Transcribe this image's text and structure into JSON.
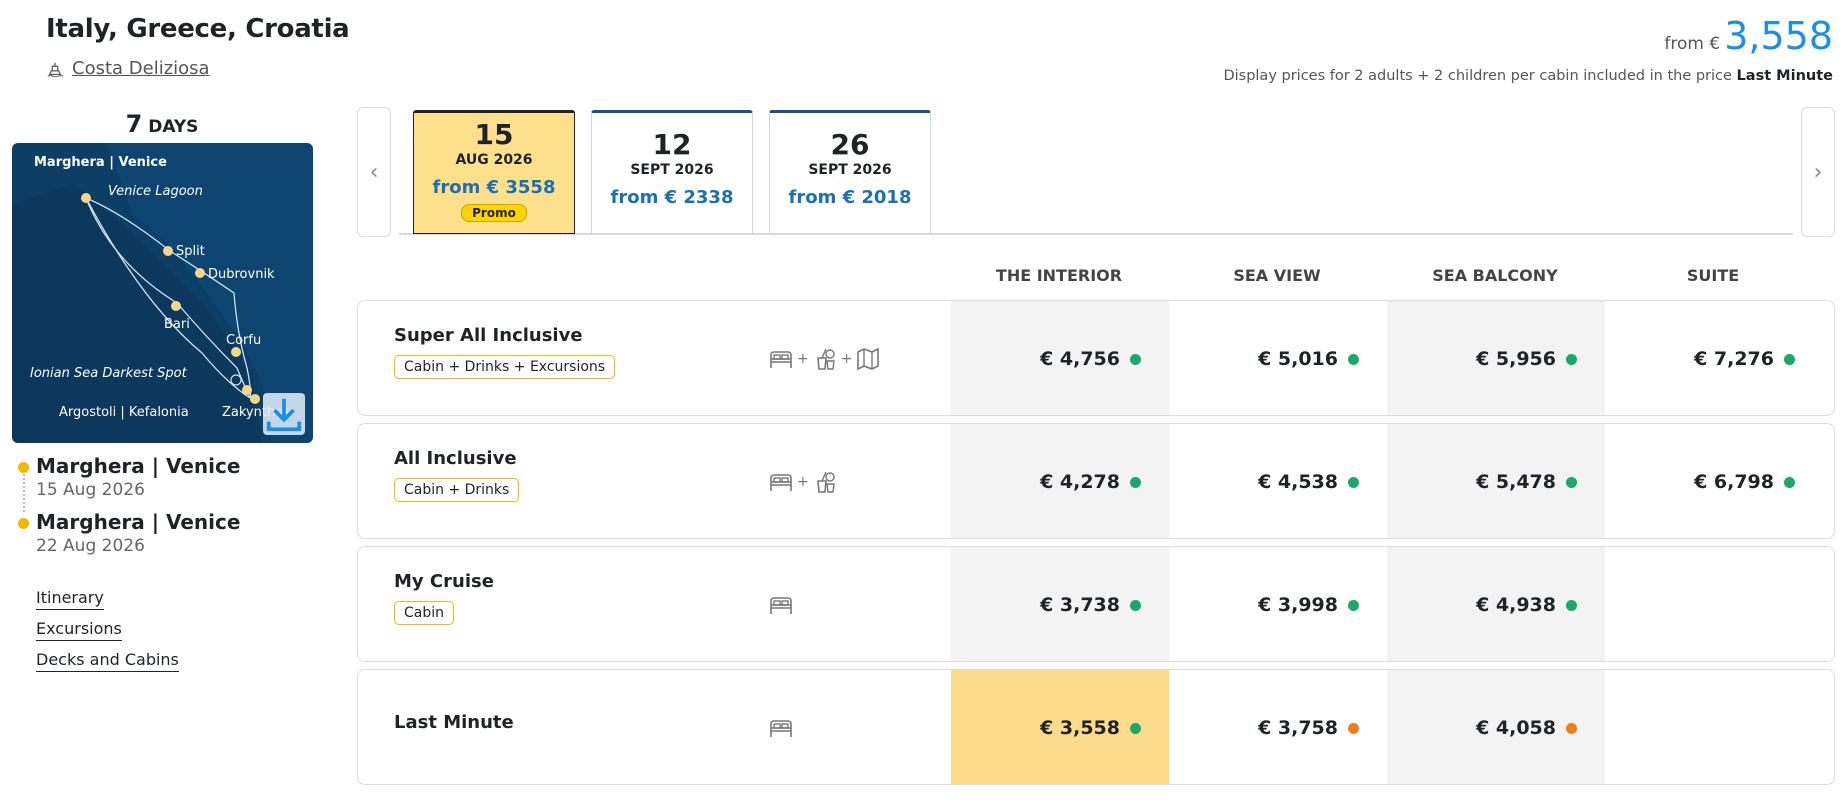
{
  "header": {
    "title": "Italy, Greece, Croatia",
    "ship_name": "Costa Deliziosa",
    "from_label": "from €",
    "from_price": "3,558",
    "subtitle_prefix": "Display prices for 2 adults + 2 children per cabin included in the price",
    "subtitle_bold": "Last Minute"
  },
  "duration": {
    "number": "7",
    "unit": "DAYS"
  },
  "map": {
    "title": "Marghera | Venice",
    "labels": [
      "Venice Lagoon",
      "Split",
      "Dubrovnik",
      "Bari",
      "Corfu",
      "Ionian Sea Darkest Spot",
      "Argostoli | Kefalonia",
      "Zakynthos"
    ],
    "download_icon": "download-icon"
  },
  "stops": [
    {
      "name": "Marghera | Venice",
      "date": "15 Aug 2026"
    },
    {
      "name": "Marghera | Venice",
      "date": "22 Aug 2026"
    }
  ],
  "links": [
    "Itinerary",
    "Excursions",
    "Decks and Cabins"
  ],
  "dates": [
    {
      "day": "15",
      "month": "AUG 2026",
      "price": "from € 3558",
      "promo": "Promo",
      "active": true
    },
    {
      "day": "12",
      "month": "SEPT 2026",
      "price": "from € 2338"
    },
    {
      "day": "26",
      "month": "SEPT 2026",
      "price": "from € 2018"
    }
  ],
  "columns": [
    "THE INTERIOR",
    "SEA VIEW",
    "SEA BALCONY",
    "SUITE"
  ],
  "plus": "+",
  "colors": {
    "accent": "#1a8fe3",
    "available": "#1aa86b",
    "limited": "#f07d1a",
    "highlight": "#fcdb8a",
    "badge_border": "#f5b800"
  },
  "rows": [
    {
      "name": "Super All Inclusive",
      "badge": "Cabin + Drinks + Excursions",
      "icons": [
        "bed-icon",
        "drinks-icon",
        "map-icon"
      ],
      "prices": [
        {
          "v": "€ 4,756",
          "s": "available"
        },
        {
          "v": "€ 5,016",
          "s": "available"
        },
        {
          "v": "€ 5,956",
          "s": "available"
        },
        {
          "v": "€ 7,276",
          "s": "available"
        }
      ]
    },
    {
      "name": "All Inclusive",
      "badge": "Cabin + Drinks",
      "icons": [
        "bed-icon",
        "drinks-icon"
      ],
      "prices": [
        {
          "v": "€ 4,278",
          "s": "available"
        },
        {
          "v": "€ 4,538",
          "s": "available"
        },
        {
          "v": "€ 5,478",
          "s": "available"
        },
        {
          "v": "€ 6,798",
          "s": "available"
        }
      ]
    },
    {
      "name": "My Cruise",
      "badge": "Cabin",
      "icons": [
        "bed-icon"
      ],
      "prices": [
        {
          "v": "€ 3,738",
          "s": "available"
        },
        {
          "v": "€ 3,998",
          "s": "available"
        },
        {
          "v": "€ 4,938",
          "s": "available"
        },
        null
      ]
    },
    {
      "name": "Last Minute",
      "badge": "",
      "icons": [
        "bed-icon"
      ],
      "prices": [
        {
          "v": "€ 3,558",
          "s": "available",
          "hl": true
        },
        {
          "v": "€ 3,758",
          "s": "limited"
        },
        {
          "v": "€ 4,058",
          "s": "limited"
        },
        null
      ]
    }
  ]
}
